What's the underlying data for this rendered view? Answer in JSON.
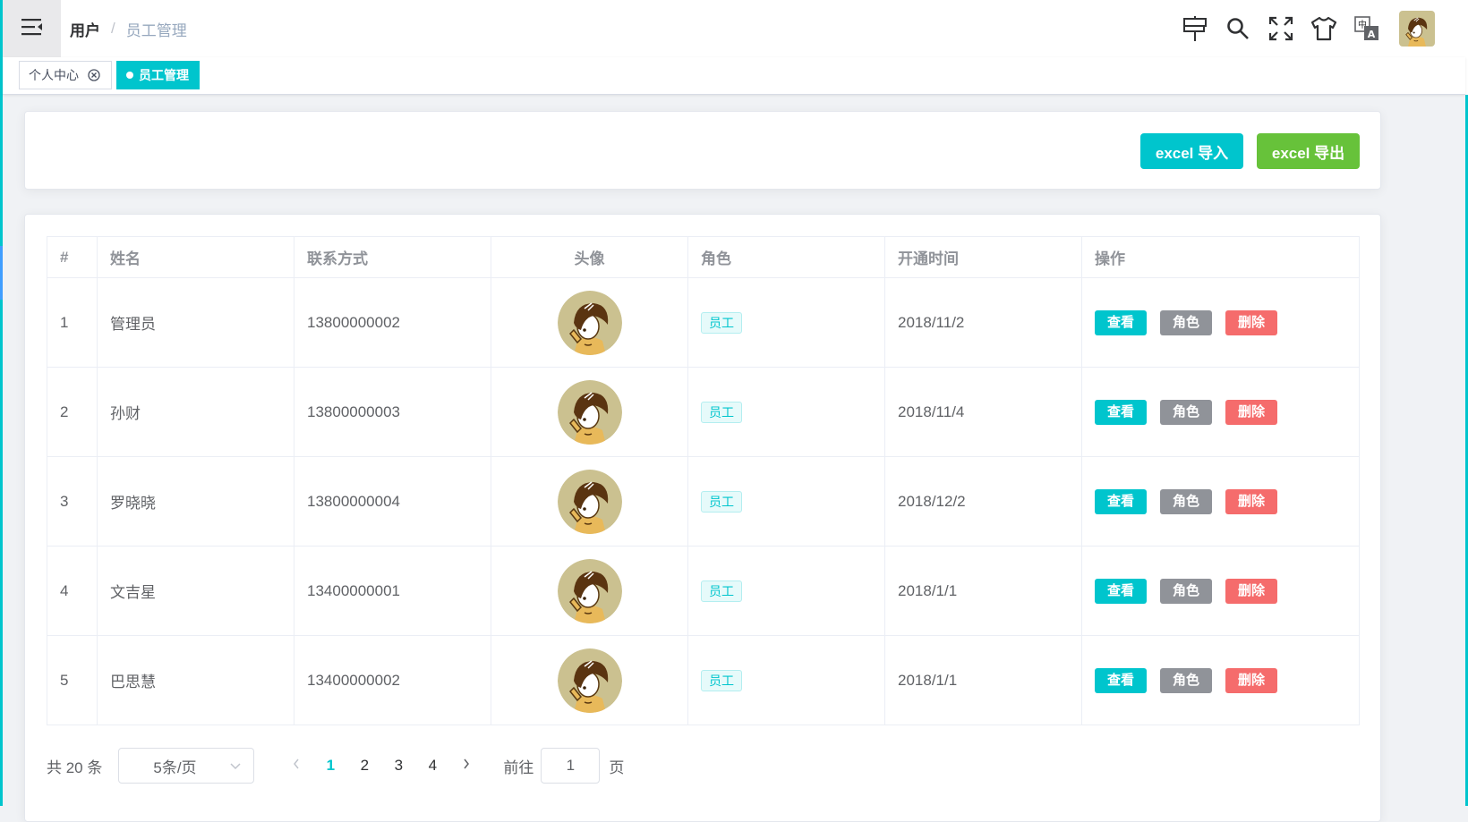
{
  "breadcrumb": {
    "root": "用户",
    "separator": "/",
    "current": "员工管理"
  },
  "navbar": {
    "icons": [
      "guide-icon",
      "search-icon",
      "fullscreen-icon",
      "theme-shirt-icon",
      "language-icon"
    ],
    "avatar": "user-avatar"
  },
  "tags": [
    {
      "label": "个人中心",
      "closable": true,
      "active": false
    },
    {
      "label": "员工管理",
      "closable": false,
      "active": true
    }
  ],
  "toolbar": {
    "import_label": "excel 导入",
    "export_label": "excel 导出"
  },
  "table": {
    "columns": [
      "#",
      "姓名",
      "联系方式",
      "头像",
      "角色",
      "开通时间",
      "操作"
    ],
    "rows": [
      {
        "index": "1",
        "name": "管理员",
        "phone": "13800000002",
        "role": "员工",
        "opened": "2018/11/2"
      },
      {
        "index": "2",
        "name": "孙财",
        "phone": "13800000003",
        "role": "员工",
        "opened": "2018/11/4"
      },
      {
        "index": "3",
        "name": "罗晓晓",
        "phone": "13800000004",
        "role": "员工",
        "opened": "2018/12/2"
      },
      {
        "index": "4",
        "name": "文吉星",
        "phone": "13400000001",
        "role": "员工",
        "opened": "2018/1/1"
      },
      {
        "index": "5",
        "name": "巴思慧",
        "phone": "13400000002",
        "role": "员工",
        "opened": "2018/1/1"
      }
    ],
    "actions": {
      "view": "查看",
      "role": "角色",
      "delete": "删除"
    }
  },
  "pagination": {
    "total_text": "共 20 条",
    "page_size": "5条/页",
    "pages": [
      "1",
      "2",
      "3",
      "4"
    ],
    "current_page": "1",
    "goto_label": "前往",
    "goto_value": "1",
    "page_unit": "页"
  },
  "colors": {
    "primary": "#00c5cd",
    "success": "#67c23a",
    "info": "#909399",
    "danger": "#f56c6c"
  }
}
